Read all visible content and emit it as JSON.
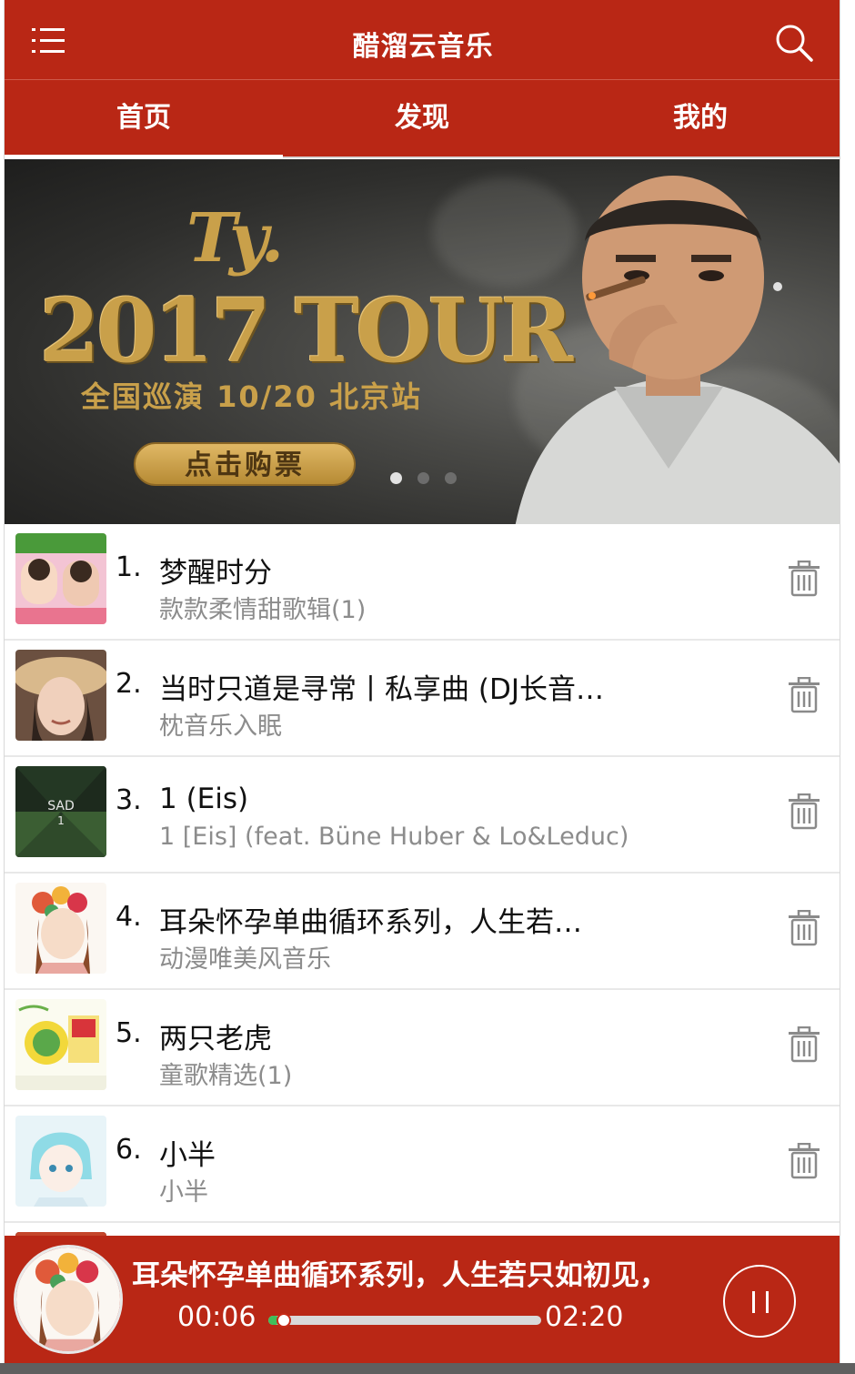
{
  "header": {
    "title": "醋溜云音乐",
    "menu_icon": "list-menu-icon",
    "search_icon": "search-icon"
  },
  "tabs": [
    {
      "label": "首页",
      "active": true
    },
    {
      "label": "发现",
      "active": false
    },
    {
      "label": "我的",
      "active": false
    }
  ],
  "banner": {
    "logo": "Ty.",
    "headline": "2017 TOUR",
    "subline": "全国巡演 10/20 北京站",
    "button_label": "点击购票",
    "slides": 3,
    "active_slide": 0
  },
  "songs": [
    {
      "number": "1.",
      "title": "梦醒时分",
      "artist": "款款柔情甜歌辑(1)",
      "delete_icon": "trash-icon"
    },
    {
      "number": "2.",
      "title": "当时只道是寻常丨私享曲 (DJ长音…",
      "artist": "枕音乐入眠",
      "delete_icon": "trash-icon"
    },
    {
      "number": "3.",
      "title": "1 (Eis)",
      "artist": "1 [Eis] (feat. Büne Huber & Lo&Leduc)",
      "delete_icon": "trash-icon"
    },
    {
      "number": "4.",
      "title": "耳朵怀孕单曲循环系列，人生若…",
      "artist": "动漫唯美风音乐",
      "delete_icon": "trash-icon"
    },
    {
      "number": "5.",
      "title": "两只老虎",
      "artist": "童歌精选(1)",
      "delete_icon": "trash-icon"
    },
    {
      "number": "6.",
      "title": "小半",
      "artist": "小半",
      "delete_icon": "trash-icon"
    }
  ],
  "player": {
    "title": "耳朵怀孕单曲循环系列，人生若只如初见，",
    "current_time": "00:06",
    "total_time": "02:20",
    "progress": 0.043,
    "state": "playing",
    "pause_icon": "pause-icon"
  },
  "colors": {
    "brand": "#b92715",
    "progress": "#3fbf5a",
    "artist_text": "#8c8c8c"
  }
}
